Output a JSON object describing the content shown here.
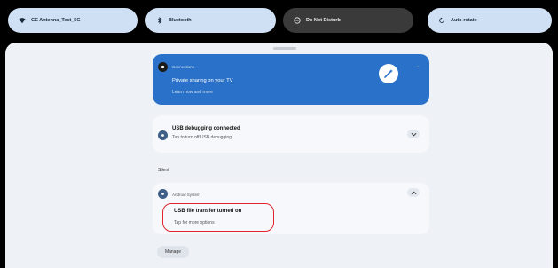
{
  "quick_settings": {
    "wifi_label": "GE Antenna_Test_5G",
    "bluetooth_label": "Bluetooth",
    "do_not_disturb_label": "Do Not Disturb",
    "auto_rotate_label": "Auto-rotate"
  },
  "notifications": {
    "promo": {
      "app_name": "Connections",
      "title": "Private sharing on your TV",
      "subtitle": "Learn how and more",
      "expand_label": "⌄"
    },
    "usb_debugging": {
      "title": "USB debugging connected",
      "subtitle": "Tap to turn off USB debugging"
    },
    "section_label": "Silent",
    "usb_transfer": {
      "app_name": "Android System",
      "title": "USB file transfer turned on",
      "subtitle": "Tap for more options"
    },
    "manage_label": "Manage"
  },
  "colors": {
    "highlight": "#e0252e",
    "promo_bg": "#2a72c9"
  }
}
